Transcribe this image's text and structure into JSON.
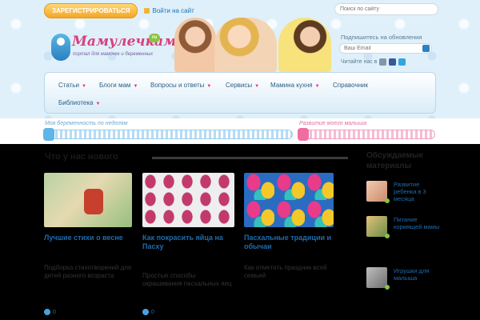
{
  "header": {
    "register_button": "ЗАРЕГИСТРИРОВАТЬСЯ",
    "login_link": "Войти на сайт",
    "search_placeholder": "Поиск по сайту",
    "logo": {
      "name": "Мамулечкам",
      "domain_badge": "ru",
      "tagline": "портал для мамочек и беременных"
    },
    "subscribe": {
      "label": "Подпишитесь на обновления",
      "email_placeholder": "Ваш Email",
      "social_label": "Читайте нас в"
    },
    "nav": [
      {
        "label": "Статьи",
        "has_dropdown": true
      },
      {
        "label": "Блоги мам",
        "has_dropdown": true
      },
      {
        "label": "Вопросы и ответы",
        "has_dropdown": true
      },
      {
        "label": "Сервисы",
        "has_dropdown": true
      },
      {
        "label": "Мамина кухня",
        "has_dropdown": true
      },
      {
        "label": "Справочник",
        "has_dropdown": false
      },
      {
        "label": "Библиотека",
        "has_dropdown": true
      }
    ]
  },
  "trackers": {
    "pregnancy_label": "Моя беременность по неделям",
    "baby_label": "Развитие моего малыша"
  },
  "main": {
    "section_title": "Что у нас нового",
    "cards": [
      {
        "title": "Лучшие стихи о весне",
        "text": "Подборка стихотворений для детей разного возраста",
        "meta": "0"
      },
      {
        "title": "Как покрасить яйца на Пасху",
        "text": "Простые способы окрашивания пасхальных яиц",
        "meta": "0"
      },
      {
        "title": "Пасхальные традиции и обычаи",
        "text": "Как отметить праздник всей семьей",
        "meta": ""
      }
    ]
  },
  "sidebar": {
    "title": "Обсуждаемые материалы",
    "items": [
      {
        "text": "Развитие ребенка в 3 месяца"
      },
      {
        "text": "Питание кормящей мамы"
      },
      {
        "text": "Игрушки для малыша"
      }
    ]
  },
  "colors": {
    "accent_pink": "#e8308c",
    "link_blue": "#1d6cae",
    "register_orange": "#f5a623"
  }
}
